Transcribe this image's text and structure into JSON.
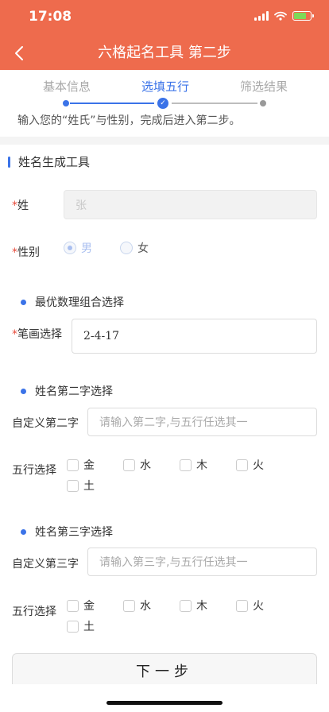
{
  "status_bar": {
    "time": "17:08"
  },
  "header": {
    "title": "六格起名工具 第二步"
  },
  "steps": {
    "items": [
      "基本信息",
      "选填五行",
      "筛选结果"
    ],
    "hint": "输入您的“姓氏”与性别，完成后进入第二步。"
  },
  "section": {
    "title": "姓名生成工具"
  },
  "surname": {
    "label": "姓",
    "required_mark": "*",
    "value": "张"
  },
  "gender": {
    "label": "性别",
    "required_mark": "*",
    "options": [
      "男",
      "女"
    ],
    "selected": "男"
  },
  "combo": {
    "title": "最优数理组合选择",
    "label": "笔画选择",
    "required_mark": "*",
    "value": "2-4-17"
  },
  "second_char": {
    "title": "姓名第二字选择",
    "custom_label": "自定义第二字",
    "placeholder": "请输入第二字,与五行任选其一",
    "wuxing_label": "五行选择",
    "options": [
      "金",
      "水",
      "木",
      "火",
      "土"
    ]
  },
  "third_char": {
    "title": "姓名第三字选择",
    "custom_label": "自定义第三字",
    "placeholder": "请输入第三字,与五行任选其一",
    "wuxing_label": "五行选择",
    "options": [
      "金",
      "水",
      "木",
      "火",
      "土"
    ]
  },
  "next_button": {
    "label": "下一步"
  },
  "colors": {
    "header": "#ee6b4d",
    "accent": "#3b73e8",
    "required": "#e74c3c"
  }
}
